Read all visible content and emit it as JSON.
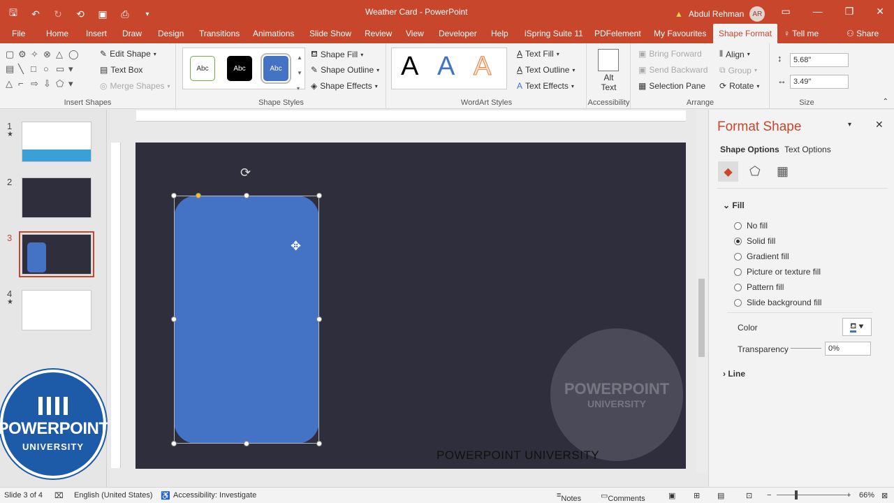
{
  "titlebar": {
    "doc_title": "Weather Card  -  PowerPoint",
    "user": "Abdul Rehman",
    "avatar_initials": "AR",
    "warning_icon": "warning-icon"
  },
  "tabs": [
    "File",
    "Home",
    "Insert",
    "Draw",
    "Design",
    "Transitions",
    "Animations",
    "Slide Show",
    "Review",
    "View",
    "Developer",
    "Help",
    "iSpring Suite 11",
    "PDFelement",
    "My Favourites",
    "Shape Format",
    "Tell me",
    "Share"
  ],
  "ribbon": {
    "insert_shapes": {
      "label": "Insert Shapes",
      "edit_shape": "Edit Shape",
      "text_box": "Text Box",
      "merge_shapes": "Merge Shapes"
    },
    "shape_styles": {
      "label": "Shape Styles",
      "style_sample": "Abc",
      "shape_fill": "Shape Fill",
      "shape_outline": "Shape Outline",
      "shape_effects": "Shape Effects"
    },
    "wordart": {
      "label": "WordArt Styles",
      "letter": "A",
      "text_fill": "Text Fill",
      "text_outline": "Text Outline",
      "text_effects": "Text Effects"
    },
    "accessibility": {
      "label": "Accessibility",
      "alt_text_1": "Alt",
      "alt_text_2": "Text"
    },
    "arrange": {
      "label": "Arrange",
      "bring_forward": "Bring Forward",
      "send_backward": "Send Backward",
      "selection_pane": "Selection Pane",
      "align": "Align",
      "group": "Group",
      "rotate": "Rotate"
    },
    "size": {
      "label": "Size",
      "height": "5.68\"",
      "width": "3.49\""
    }
  },
  "slides": [
    {
      "num": "1",
      "star": "★"
    },
    {
      "num": "2",
      "star": ""
    },
    {
      "num": "3",
      "star": ""
    },
    {
      "num": "4",
      "star": "★"
    }
  ],
  "slide": {
    "footer": "POWERPOINT UNIVERSITY",
    "watermark_1": "POWERPOINT",
    "watermark_2": "UNIVERSITY",
    "colors": {
      "background": "#2f2e3d",
      "card": "#4472c4"
    }
  },
  "logo": {
    "line1": "POWERPOINT",
    "line2": "UNIVERSITY"
  },
  "pane": {
    "title": "Format Shape",
    "tab_shape": "Shape Options",
    "tab_text": "Text Options",
    "fill_header": "Fill",
    "fill_options": [
      {
        "label": "No fill",
        "selected": false
      },
      {
        "label": "Solid fill",
        "selected": true
      },
      {
        "label": "Gradient fill",
        "selected": false
      },
      {
        "label": "Picture or texture fill",
        "selected": false
      },
      {
        "label": "Pattern fill",
        "selected": false
      },
      {
        "label": "Slide background fill",
        "selected": false
      }
    ],
    "color_label": "Color",
    "transparency_label": "Transparency",
    "transparency_value": "0%",
    "line_header": "Line"
  },
  "status": {
    "slide": "Slide 3 of 4",
    "language": "English (United States)",
    "accessibility": "Accessibility: Investigate",
    "notes": "Notes",
    "comments": "Comments",
    "zoom": "66%"
  }
}
